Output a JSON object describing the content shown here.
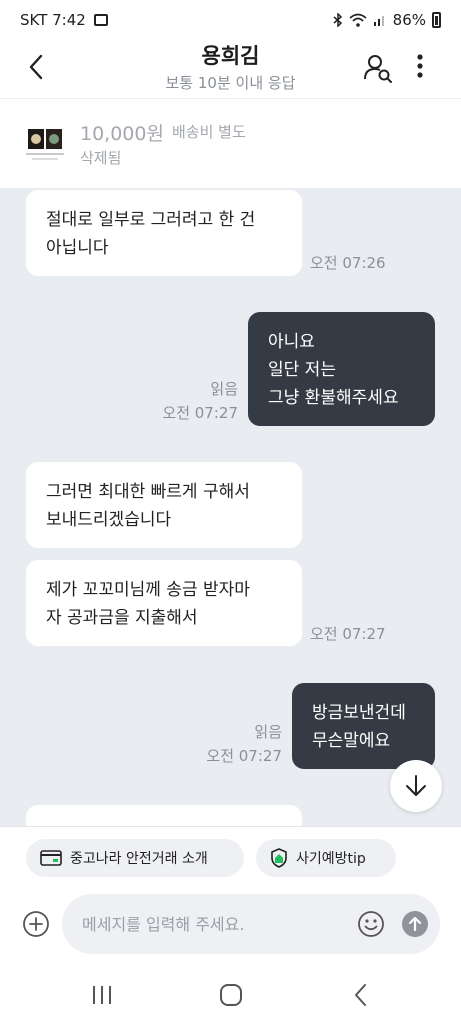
{
  "status_bar": {
    "carrier_time": "SKT 7:42",
    "battery": "86%"
  },
  "header": {
    "title": "용희김",
    "subtitle": "보통 10분 이내 응답"
  },
  "product": {
    "price": "10,000원",
    "shipping": "배송비 별도",
    "status": "삭제됨"
  },
  "messages": [
    {
      "side": "in",
      "lines": [
        "절대로 일부로 그러려고 한 건",
        "아닙니다"
      ],
      "time": "오전 07:26"
    },
    {
      "side": "out",
      "lines": [
        "아니요",
        "일단 저는",
        "그냥 환불해주세요"
      ],
      "read": "읽음",
      "time": "오전 07:27"
    },
    {
      "side": "in",
      "lines": [
        "그러면 최대한 빠르게 구해서",
        "보내드리겠습니다"
      ]
    },
    {
      "side": "in",
      "lines": [
        "제가 꼬꼬미님께 송금 받자마",
        "자 공과금을 지출해서"
      ],
      "time": "오전 07:27"
    },
    {
      "side": "out",
      "lines": [
        "방금보낸건데",
        "무슨말에요"
      ],
      "read": "읽음",
      "time": "오전 07:27"
    }
  ],
  "chips": {
    "safe_trade": "중고나라 안전거래 소개",
    "fraud_tip": "사기예방tip"
  },
  "input": {
    "placeholder": "메세지를 입력해 주세요."
  },
  "icons": [
    "back-icon",
    "user-search-icon",
    "more-vertical-icon",
    "card-icon",
    "shield-icon",
    "plus-circle-icon",
    "emoji-icon",
    "send-icon",
    "arrow-down-icon",
    "recents-icon",
    "home-icon",
    "nav-back-icon"
  ],
  "colors": {
    "outgoing_bubble": "#353b44",
    "chat_background": "#e9ecf1",
    "incoming_bubble": "#ffffff"
  }
}
